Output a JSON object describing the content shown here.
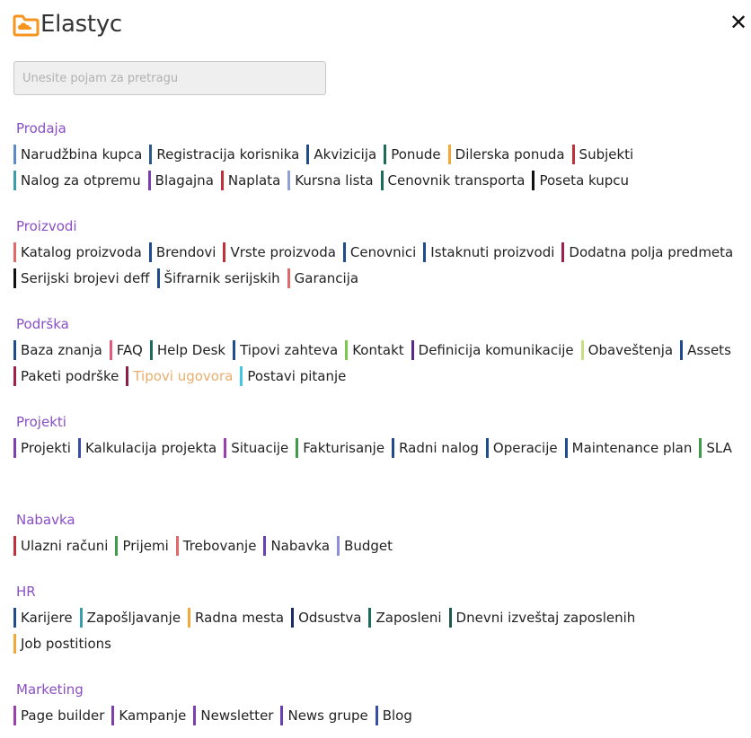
{
  "app": {
    "title": "Elastyc",
    "logo_icon": "cloud-folder-icon",
    "logo_color": "#f7941d",
    "close_icon": "close-icon",
    "close_symbol": "✕"
  },
  "search": {
    "placeholder": "Unesite pojam za pretragu",
    "value": ""
  },
  "sections": [
    {
      "title": "Prodaja",
      "items": [
        {
          "label": "Narudžbina kupca",
          "color": "#5b8cc8"
        },
        {
          "label": "Registracija korisnika",
          "color": "#2b5a88"
        },
        {
          "label": "Akvizicija",
          "color": "#1f4c8c"
        },
        {
          "label": "Ponude",
          "color": "#1d6b5c"
        },
        {
          "label": "Dilerska ponuda",
          "color": "#f2a93b"
        },
        {
          "label": "Subjekti",
          "color": "#c0303a"
        },
        {
          "label": "Nalog za otpremu",
          "color": "#3a9eaa"
        },
        {
          "label": "Blagajna",
          "color": "#7b3fb0"
        },
        {
          "label": "Naplata",
          "color": "#c0303a"
        },
        {
          "label": "Kursna lista",
          "color": "#8fa0d8"
        },
        {
          "label": "Cenovnik transporta",
          "color": "#1d6b5c"
        },
        {
          "label": "Poseta kupcu",
          "color": "#111111"
        }
      ]
    },
    {
      "title": "Proizvodi",
      "items": [
        {
          "label": "Katalog proizvoda",
          "color": "#e06a6a"
        },
        {
          "label": "Brendovi",
          "color": "#1f4c8c"
        },
        {
          "label": "Vrste proizvoda",
          "color": "#c0303a"
        },
        {
          "label": "Cenovnici",
          "color": "#1f4c8c"
        },
        {
          "label": "Istaknuti proizvodi",
          "color": "#1f4c8c"
        },
        {
          "label": "Dodatna polja predmeta",
          "color": "#a0204a"
        },
        {
          "label": "Serijski brojevi deff",
          "color": "#111111"
        },
        {
          "label": "Šifrarnik serijskih",
          "color": "#1f4c8c"
        },
        {
          "label": "Garancija",
          "color": "#e06a6a"
        }
      ]
    },
    {
      "title": "Podrška",
      "items": [
        {
          "label": "Baza znanja",
          "color": "#1f4c8c"
        },
        {
          "label": "FAQ",
          "color": "#e05a7a"
        },
        {
          "label": "Help Desk",
          "color": "#1d6b5c"
        },
        {
          "label": "Tipovi zahteva",
          "color": "#1f4c8c"
        },
        {
          "label": "Kontakt",
          "color": "#7cc84a"
        },
        {
          "label": "Definicija komunikacije",
          "color": "#5a2a8a"
        },
        {
          "label": "Obaveštenja",
          "color": "#c7df80"
        },
        {
          "label": "Assets",
          "color": "#1f4c8c"
        },
        {
          "label": "Paketi podrške",
          "color": "#a0204a"
        },
        {
          "label": "Tipovi ugovora",
          "color": "#8a1f4a",
          "muted": true
        },
        {
          "label": "Postavi pitanje",
          "color": "#42c9e0"
        }
      ]
    },
    {
      "title": "Projekti",
      "items": [
        {
          "label": "Projekti",
          "color": "#7b3fb0"
        },
        {
          "label": "Kalkulacija projekta",
          "color": "#3a4ea8"
        },
        {
          "label": "Situacije",
          "color": "#9a3fb0"
        },
        {
          "label": "Fakturisanje",
          "color": "#3f9a4a"
        },
        {
          "label": "Radni nalog",
          "color": "#1f4c8c"
        },
        {
          "label": "Operacije",
          "color": "#1f4c8c"
        },
        {
          "label": "Maintenance plan",
          "color": "#1f4c8c"
        },
        {
          "label": "SLA",
          "color": "#3f9a4a"
        }
      ]
    },
    {
      "title": "Nabavka",
      "items": [
        {
          "label": "Ulazni računi",
          "color": "#c0303a"
        },
        {
          "label": "Prijemi",
          "color": "#3f9a4a"
        },
        {
          "label": "Trebovanje",
          "color": "#e06a6a"
        },
        {
          "label": "Nabavka",
          "color": "#6a3fb0"
        },
        {
          "label": "Budget",
          "color": "#8f8fd8"
        }
      ]
    },
    {
      "title": "HR",
      "items": [
        {
          "label": "Karijere",
          "color": "#1f4c8c"
        },
        {
          "label": "Zapošljavanje",
          "color": "#3a9eaa"
        },
        {
          "label": "Radna mesta",
          "color": "#f2a93b"
        },
        {
          "label": "Odsustva",
          "color": "#1a2a6a"
        },
        {
          "label": "Zaposleni",
          "color": "#1d6b5c"
        },
        {
          "label": "Dnevni izveštaj zaposlenih",
          "color": "#1d5a4a"
        },
        {
          "label": "Job postitions",
          "color": "#f2a93b"
        }
      ]
    },
    {
      "title": "Marketing",
      "items": [
        {
          "label": "Page builder",
          "color": "#9a3fb0"
        },
        {
          "label": "Kampanje",
          "color": "#7b3fb0"
        },
        {
          "label": "Newsletter",
          "color": "#7b3fb0"
        },
        {
          "label": "News grupe",
          "color": "#6a3fb0"
        },
        {
          "label": "Blog",
          "color": "#3a4ea8"
        }
      ]
    }
  ]
}
